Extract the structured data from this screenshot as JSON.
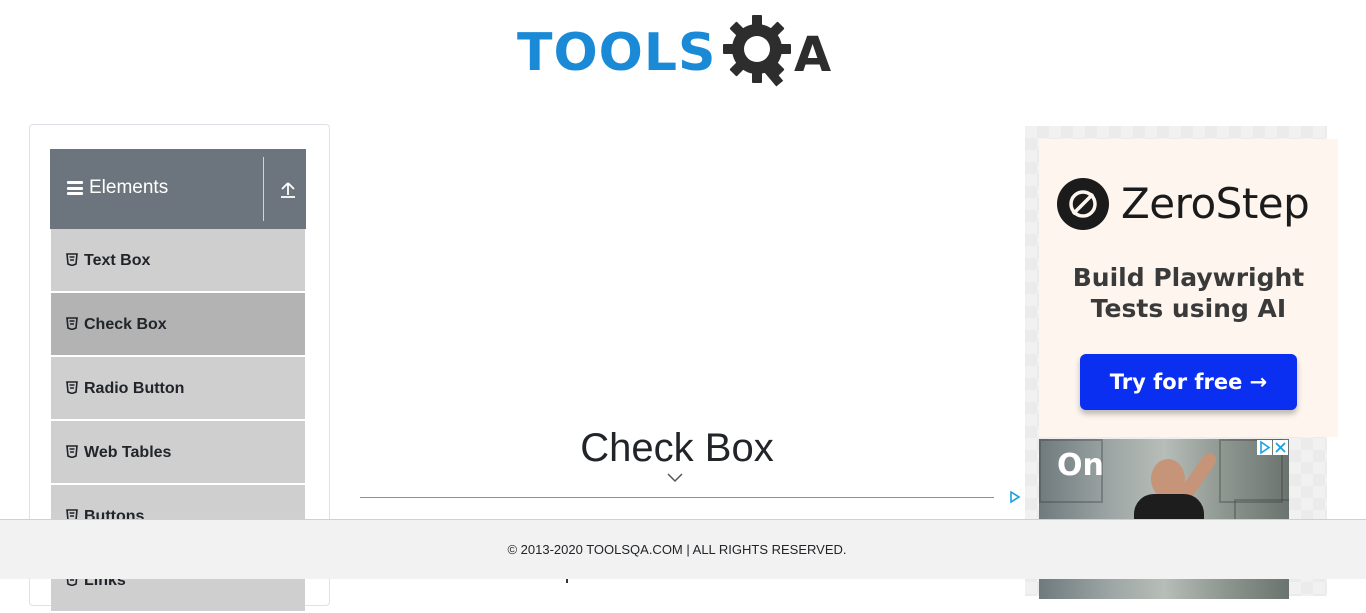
{
  "brand": {
    "logo_text": "TOOLS",
    "logo_qa": "A",
    "logo_alt": "TOOLSQA"
  },
  "sidebar": {
    "group_title": "Elements",
    "items": [
      {
        "label": "Text Box",
        "active": false
      },
      {
        "label": "Check Box",
        "active": true
      },
      {
        "label": "Radio Button",
        "active": false
      },
      {
        "label": "Web Tables",
        "active": false
      },
      {
        "label": "Buttons",
        "active": false
      },
      {
        "label": "Links",
        "active": false
      }
    ]
  },
  "main": {
    "title": "Check Box"
  },
  "ads": {
    "zerostep": {
      "brand": "ZeroStep",
      "headline_line1": "Build Playwright",
      "headline_line2": "Tests using AI",
      "cta": "Try for free →"
    },
    "photo": {
      "logo": "On"
    }
  },
  "footer": {
    "copyright": "© 2013-2020 TOOLSQA.COM | ALL RIGHTS RESERVED."
  },
  "colors": {
    "header_bg": "#6c757d",
    "menu_item_bg": "#cfcfcf",
    "menu_item_active_bg": "#b3b3b3",
    "logo_blue": "#1a8ad6",
    "cta_blue": "#0a2ff0",
    "footer_bg": "#f2f2f2"
  }
}
